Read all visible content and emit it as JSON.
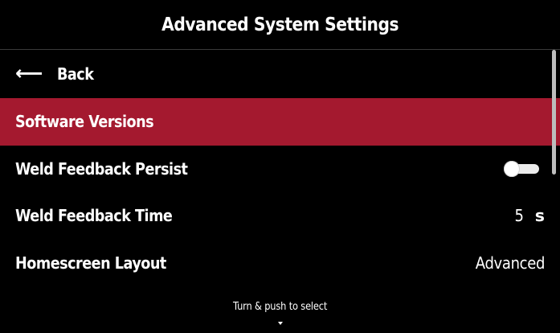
{
  "header": {
    "title": "Advanced System Settings"
  },
  "menu": {
    "back": {
      "icon": "return-arrow-icon",
      "arrow_glyph": "↩",
      "label": "Back"
    },
    "items": [
      {
        "label": "Software Versions",
        "selected": true
      },
      {
        "label": "Weld Feedback Persist",
        "control": "toggle",
        "toggle_on": false
      },
      {
        "label": "Weld Feedback Time",
        "value": "5",
        "unit": "s"
      },
      {
        "label": "Homescreen Layout",
        "value": "Advanced"
      }
    ]
  },
  "footer": {
    "hint": "Turn & push to select",
    "icon": "caret-down-icon"
  },
  "colors": {
    "background": "#000000",
    "selected_row": "#a4192f",
    "text": "#ffffff",
    "scrollbar": "#bdbdbd"
  }
}
